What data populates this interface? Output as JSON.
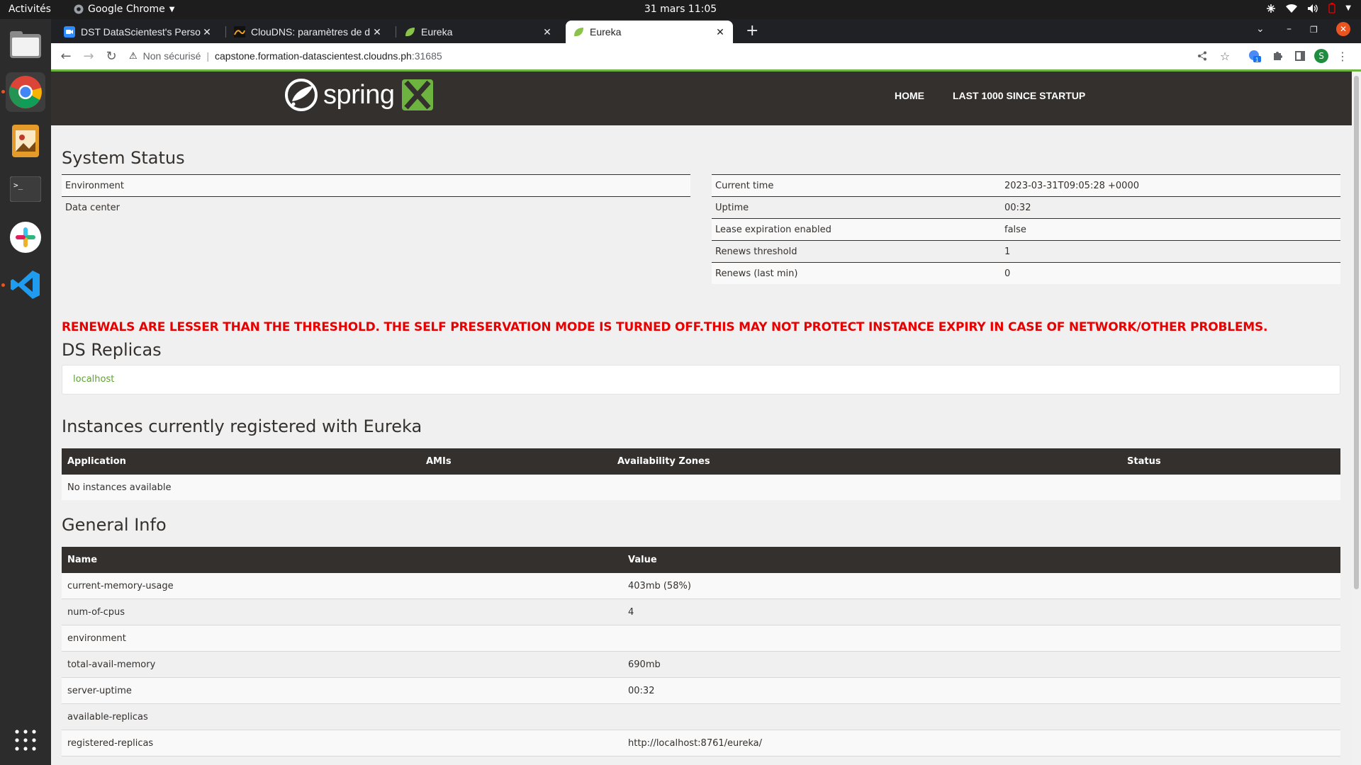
{
  "topbar": {
    "activities": "Activités",
    "app_name": "Google Chrome",
    "clock": "31 mars  11:05"
  },
  "chrome": {
    "tabs": [
      {
        "title": "DST DataScientest's Perso",
        "icon": "video-chat-icon"
      },
      {
        "title": "ClouDNS: paramètres de d",
        "icon": "cloudns-icon"
      },
      {
        "title": "Eureka",
        "icon": "spring-leaf-icon"
      },
      {
        "title": "Eureka",
        "icon": "spring-leaf-icon"
      }
    ],
    "address": {
      "security_label": "Non sécurisé",
      "host": "capstone.formation-datascientest.cloudns.ph",
      "port": ":31685"
    },
    "profile_initial": "S",
    "extension_badge": "1"
  },
  "page": {
    "brand": "spring",
    "nav": [
      "HOME",
      "LAST 1000 SINCE STARTUP"
    ],
    "system_status": {
      "title": "System Status",
      "left": [
        {
          "name": "Environment",
          "value": ""
        },
        {
          "name": "Data center",
          "value": ""
        }
      ],
      "right": [
        {
          "name": "Current time",
          "value": "2023-03-31T09:05:28 +0000"
        },
        {
          "name": "Uptime",
          "value": "00:32"
        },
        {
          "name": "Lease expiration enabled",
          "value": "false"
        },
        {
          "name": "Renews threshold",
          "value": "1"
        },
        {
          "name": "Renews (last min)",
          "value": "0"
        }
      ]
    },
    "warning": "RENEWALS ARE LESSER THAN THE THRESHOLD. THE SELF PRESERVATION MODE IS TURNED OFF.THIS MAY NOT PROTECT INSTANCE EXPIRY IN CASE OF NETWORK/OTHER PROBLEMS.",
    "replicas": {
      "title": "DS Replicas",
      "items": [
        "localhost"
      ]
    },
    "instances": {
      "title": "Instances currently registered with Eureka",
      "headers": [
        "Application",
        "AMIs",
        "Availability Zones",
        "Status"
      ],
      "empty": "No instances available"
    },
    "general_info": {
      "title": "General Info",
      "headers": [
        "Name",
        "Value"
      ],
      "rows": [
        {
          "name": "current-memory-usage",
          "value": "403mb (58%)"
        },
        {
          "name": "num-of-cpus",
          "value": "4"
        },
        {
          "name": "environment",
          "value": ""
        },
        {
          "name": "total-avail-memory",
          "value": "690mb"
        },
        {
          "name": "server-uptime",
          "value": "00:32"
        },
        {
          "name": "available-replicas",
          "value": ""
        },
        {
          "name": "registered-replicas",
          "value": "http://localhost:8761/eureka/"
        }
      ]
    }
  },
  "colors": {
    "spring_dark": "#34302d",
    "spring_green": "#6db33f",
    "warning_red": "#e80000"
  }
}
